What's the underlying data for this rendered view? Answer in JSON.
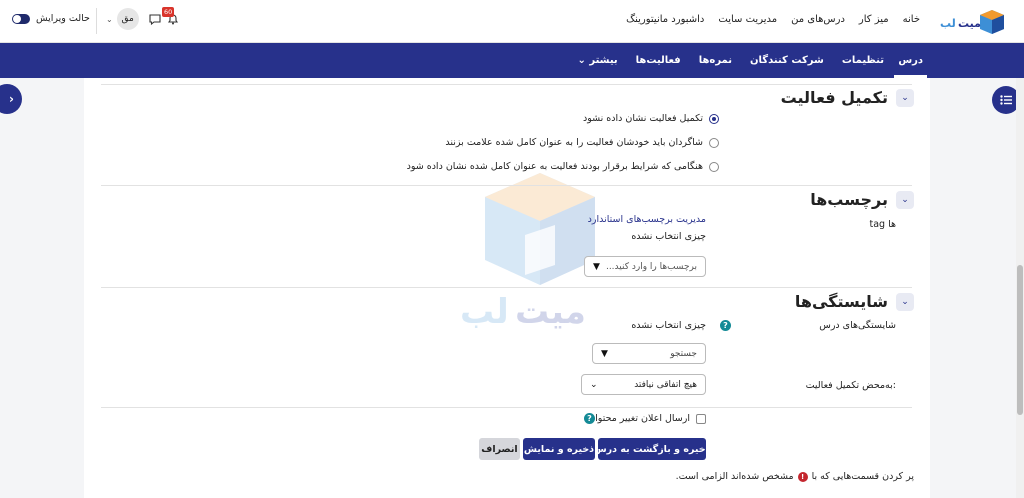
{
  "topbar": {
    "brand": "میت لب",
    "nav": [
      "خانه",
      "میز کار",
      "درس‌های من",
      "مدیریت سایت",
      "داشبورد مانیتورینگ"
    ],
    "notification_count": "60",
    "user_initials": "مق",
    "edit_mode_label": "حالت ویرایش"
  },
  "secondary_nav": {
    "items": [
      "درس",
      "تنظیمات",
      "شرکت کنندگان",
      "نمره‌ها",
      "فعالیت‌ها",
      "بیشتر"
    ]
  },
  "completion": {
    "title": "تکمیل فعالیت",
    "options": [
      "تکمیل فعالیت نشان داده نشود",
      "شاگردان باید خودشان فعالیت را به عنوان کامل شده علامت بزنند",
      "هنگامی که شرایط برقرار بودند فعالیت به عنوان کامل شده نشان داده شود"
    ],
    "selected_index": 0
  },
  "tags": {
    "title": "برچسب‌ها",
    "field_label": "tag ها",
    "manage_link": "مدیریت برچسب‌های استاندارد",
    "none_selected": "چیزی انتخاب نشده",
    "input_placeholder": "برچسب‌ها را وارد کنید..."
  },
  "competencies": {
    "title": "شایستگی‌ها",
    "course_competencies_label": "شایستگی‌های درس",
    "none_selected": "چیزی انتخاب نشده",
    "search_placeholder": "جستجو",
    "upon_completion_label": "به‌محض تکمیل فعالیت:",
    "upon_completion_value": "هیچ اتفاقی نیافتد",
    "notify_label": "ارسال اعلان تغییر محتوا"
  },
  "actions": {
    "save_return": "ذخیره و بازگشت به درس",
    "save_display": "ذخیره و نمایش",
    "cancel": "انصراف"
  },
  "required_note": {
    "before": "پر کردن قسمت‌هایی که با",
    "after": "مشخص شده‌اند الزامی است."
  },
  "colors": {
    "primary": "#27318b",
    "help": "#148a96",
    "required": "#c4262e"
  }
}
